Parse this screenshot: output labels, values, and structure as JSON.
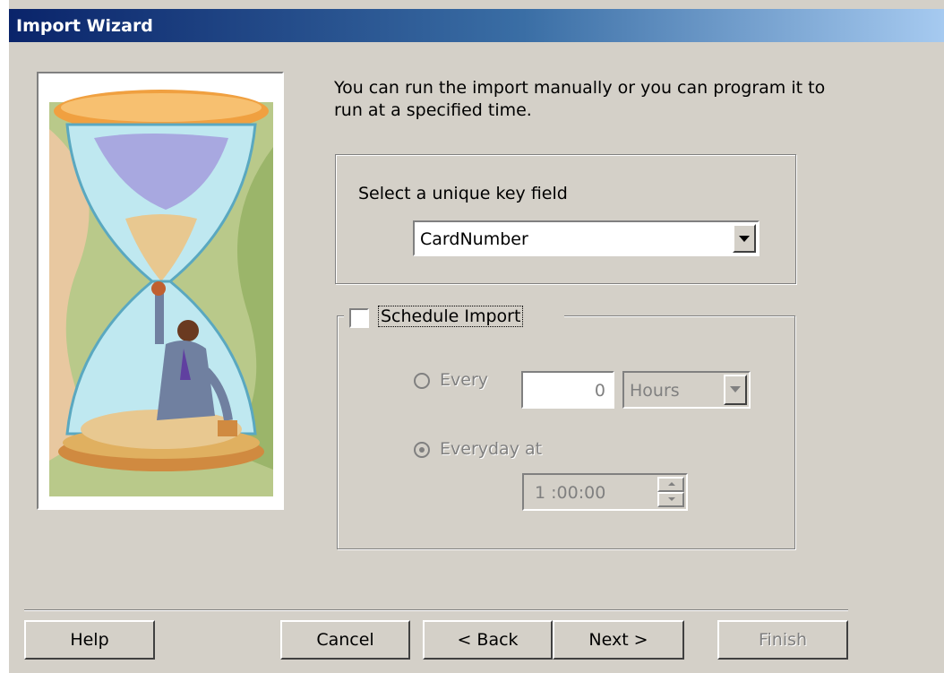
{
  "window": {
    "title": "Import Wizard"
  },
  "intro_text": "You can run the import manually or you can program it to run at a specified time.",
  "key_field": {
    "label": "Select a unique key field",
    "selected": "CardNumber"
  },
  "schedule": {
    "checkbox_label": "Schedule Import",
    "checked": false,
    "every_label": "Every",
    "every_value": "0",
    "every_unit": "Hours",
    "everyday_label": "Everyday at",
    "everyday_selected": true,
    "time_value": "1 :00:00"
  },
  "buttons": {
    "help": "Help",
    "cancel": "Cancel",
    "back": "< Back",
    "next": "Next >",
    "finish": "Finish"
  },
  "icons": {
    "illustration": "hourglass-businessman-illustration",
    "combo_arrow": "chevron-down-icon",
    "spin": "spin-updown-icon"
  }
}
